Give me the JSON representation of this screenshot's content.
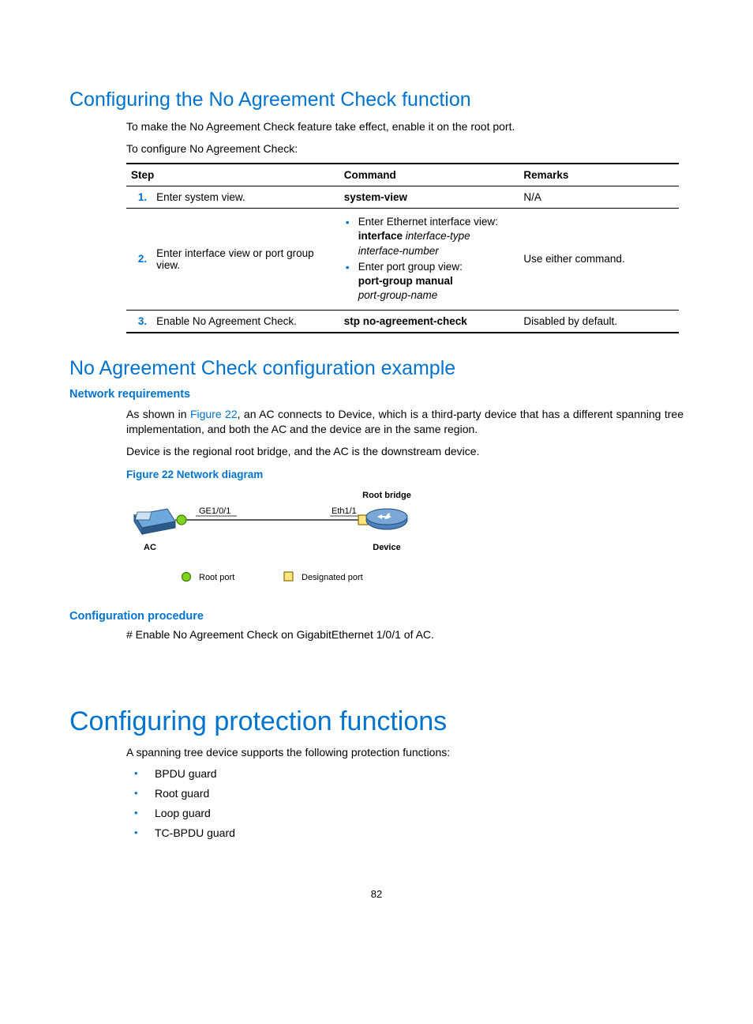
{
  "section1": {
    "title": "Configuring the No Agreement Check function",
    "p1": "To make the No Agreement Check feature take effect, enable it on the root port.",
    "p2": "To configure No Agreement Check:",
    "table": {
      "headers": {
        "step": "Step",
        "command": "Command",
        "remarks": "Remarks"
      },
      "rows": [
        {
          "num": "1.",
          "desc": "Enter system view.",
          "cmd_plain": "system-view",
          "remarks": "N/A"
        },
        {
          "num": "2.",
          "desc": "Enter interface view or port group view.",
          "cmd_items": [
            {
              "lead": "Enter Ethernet interface view:",
              "bold": "interface",
              "ital": "interface-type interface-number"
            },
            {
              "lead": "Enter port group view:",
              "bold": "port-group manual",
              "ital": "port-group-name"
            }
          ],
          "remarks": "Use either command."
        },
        {
          "num": "3.",
          "desc": "Enable No Agreement Check.",
          "cmd_plain": "stp no-agreement-check",
          "remarks": "Disabled by default."
        }
      ]
    }
  },
  "section2": {
    "title": "No Agreement Check configuration example",
    "sub1": "Network requirements",
    "p1_pre": "As shown in ",
    "p1_link": "Figure 22",
    "p1_post": ", an AC connects to Device, which is a third-party device that has a different spanning tree implementation, and both the AC and the device are in the same region.",
    "p2": "Device is the regional root bridge, and the AC is the downstream device.",
    "figcap": "Figure 22 Network diagram",
    "diagram": {
      "root_bridge": "Root bridge",
      "ge": "GE1/0/1",
      "eth": "Eth1/1",
      "ac": "AC",
      "device": "Device",
      "root_port": "Root port",
      "desig_port": "Designated port"
    },
    "sub2": "Configuration procedure",
    "p3": "# Enable No Agreement Check on GigabitEthernet 1/0/1 of AC."
  },
  "section3": {
    "title": "Configuring protection functions",
    "p1": "A spanning tree device supports the following protection functions:",
    "bullets": [
      "BPDU guard",
      "Root guard",
      "Loop guard",
      "TC-BPDU guard"
    ]
  },
  "page_number": "82"
}
